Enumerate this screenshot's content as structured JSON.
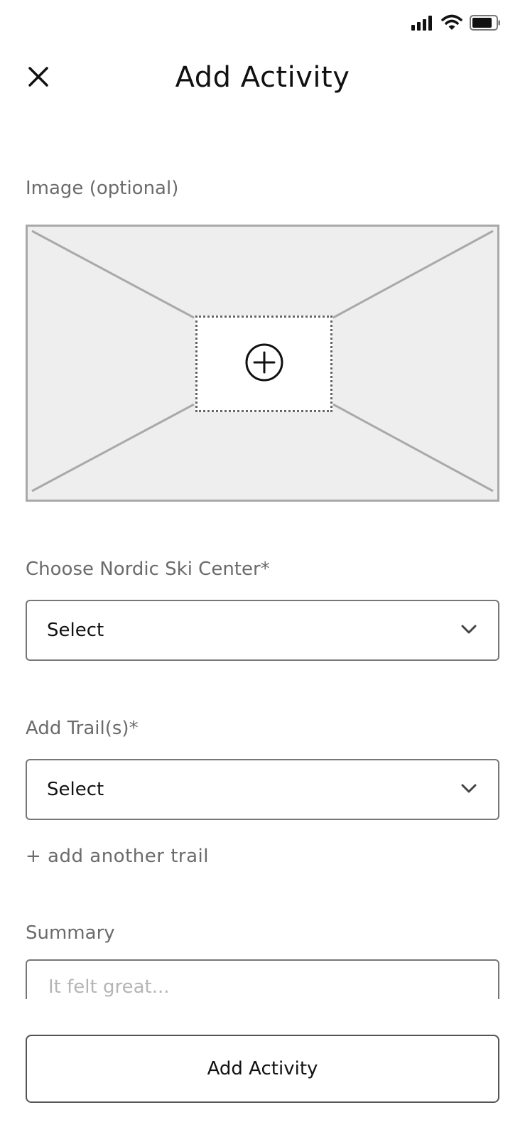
{
  "status_bar": {
    "icons": [
      "signal-icon",
      "wifi-icon",
      "battery-icon"
    ]
  },
  "header": {
    "title": "Add Activity",
    "close_icon": "close-icon"
  },
  "image_field": {
    "label": "Image (optional)",
    "upload_icon": "plus-circle-icon"
  },
  "ski_center_field": {
    "label": "Choose Nordic Ski Center*",
    "value": "Select",
    "icon": "chevron-down-icon"
  },
  "trail_field": {
    "label": "Add Trail(s)*",
    "value": "Select",
    "icon": "chevron-down-icon",
    "add_another_label": "+ add another trail"
  },
  "summary_field": {
    "label": "Summary",
    "placeholder": "It felt great..."
  },
  "submit_button": {
    "label": "Add Activity"
  },
  "colors": {
    "placeholder_bg": "#eeeeee",
    "placeholder_border": "#a9a9a9",
    "label_text": "#6b6b6b",
    "input_border": "#777777"
  }
}
